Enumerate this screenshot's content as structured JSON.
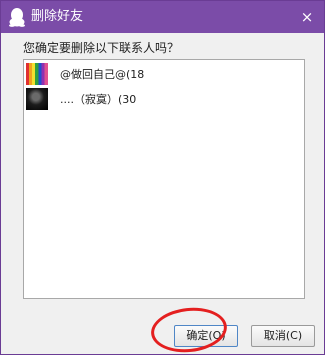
{
  "window": {
    "title": "删除好友",
    "title_bar_color": "#7b4ca8",
    "app_icon": "qq-penguin-icon",
    "close_label": "×"
  },
  "dialog": {
    "prompt": "您确定要删除以下联系人吗？",
    "contacts": [
      {
        "label": "@做回自己@(18",
        "avatar": "rainbow-avatar"
      },
      {
        "label": "....（寂寞）(30",
        "avatar": "dark-avatar"
      }
    ]
  },
  "buttons": {
    "ok_label": "确定(O)",
    "cancel_label": "取消(C)"
  },
  "accent_colors": {
    "annotation": "#e41f1f"
  }
}
